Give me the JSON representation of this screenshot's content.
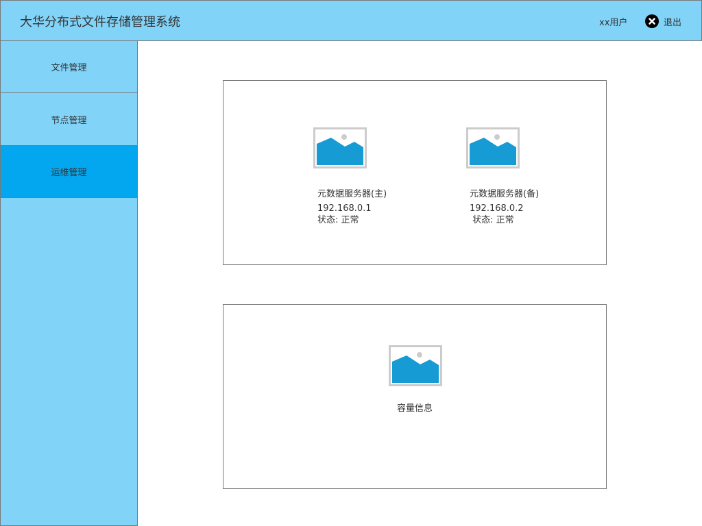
{
  "header": {
    "title": "大华分布式文件存储管理系统",
    "user": "xx用户",
    "logout_label": "退出",
    "logout_icon": "close-circle-icon"
  },
  "sidebar": {
    "items": [
      {
        "label": "文件管理",
        "active": false
      },
      {
        "label": "节点管理",
        "active": false
      },
      {
        "label": "运维管理",
        "active": true
      }
    ]
  },
  "servers": [
    {
      "name": "元数据服务器(主)",
      "ip": "192.168.0.1",
      "status": "状态: 正常",
      "icon": "image-placeholder-icon"
    },
    {
      "name": "元数据服务器(备)",
      "ip": "192.168.0.2",
      "status": " 状态: 正常",
      "icon": "image-placeholder-icon"
    }
  ],
  "capacity": {
    "label": "容量信息",
    "icon": "image-placeholder-icon"
  },
  "colors": {
    "header_bg": "#81d3f8",
    "sidebar_bg": "#81d3f8",
    "active_bg": "#02a7f0",
    "border": "#797979",
    "image_blue": "#169bd5",
    "image_frame": "#cccccc"
  }
}
